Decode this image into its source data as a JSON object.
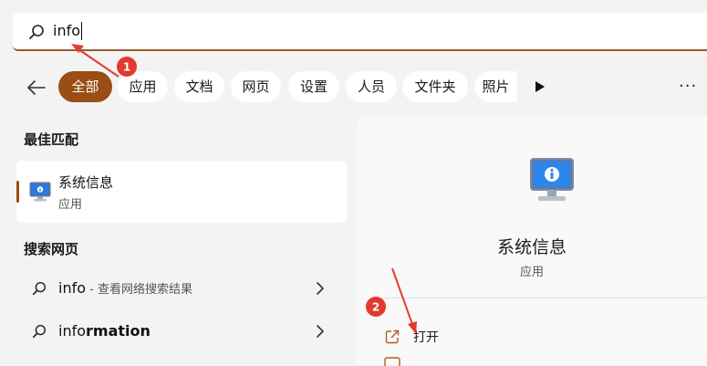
{
  "search": {
    "query": "info"
  },
  "filters": {
    "chips": [
      {
        "label": "全部",
        "active": true
      },
      {
        "label": "应用"
      },
      {
        "label": "文档"
      },
      {
        "label": "网页"
      },
      {
        "label": "设置"
      },
      {
        "label": "人员"
      },
      {
        "label": "文件夹"
      },
      {
        "label": "照片"
      }
    ],
    "more_label": "···"
  },
  "best_match": {
    "title": "最佳匹配",
    "item": {
      "name": "系统信息",
      "type": "应用"
    }
  },
  "web_search": {
    "title": "搜索网页",
    "items": [
      {
        "query": "info",
        "suffix": " - 查看网络搜索结果"
      },
      {
        "prefix": "info",
        "bold_part": "rmation"
      }
    ]
  },
  "preview": {
    "name": "系统信息",
    "type": "应用",
    "actions": [
      {
        "label": "打开",
        "icon": "open-external-icon"
      }
    ]
  },
  "annotations": [
    {
      "number": "1"
    },
    {
      "number": "2"
    }
  ],
  "colors": {
    "accent": "#9a4d14",
    "annotation": "#e23b2e"
  }
}
